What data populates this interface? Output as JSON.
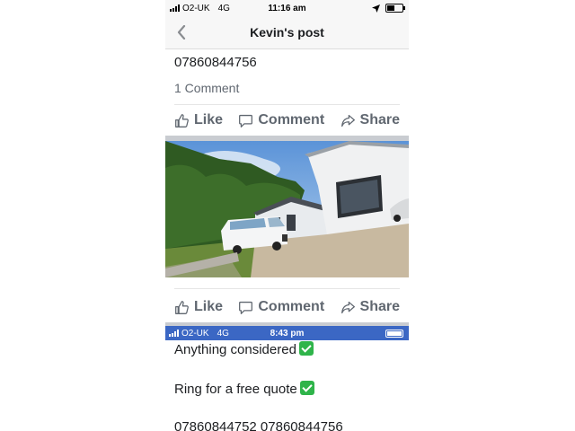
{
  "status_bar": {
    "carrier": "O2-UK",
    "network": "4G",
    "time": "11:16 am"
  },
  "nav": {
    "title": "Kevin's post"
  },
  "post": {
    "phone_text": "07860844756",
    "comment_count": "1 Comment"
  },
  "actions": {
    "like": "Like",
    "comment": "Comment",
    "share": "Share"
  },
  "embedded_status_bar": {
    "carrier": "O2-UK",
    "network": "4G",
    "time": "8:43 pm"
  },
  "lower_text": {
    "line1": "Anything considered",
    "line2": "Ring for a free quote",
    "line3": "07860844752 07860844756"
  },
  "icons": {
    "back": "chevron-left-icon",
    "like": "thumbs-up-icon",
    "comment": "speech-bubble-icon",
    "share": "share-arrow-icon",
    "check": "check-mark-icon",
    "location": "location-arrow-icon",
    "battery": "battery-icon"
  },
  "colors": {
    "accent_blue": "#3b67c4",
    "action_gray": "#606770",
    "check_green": "#2fb44a"
  }
}
